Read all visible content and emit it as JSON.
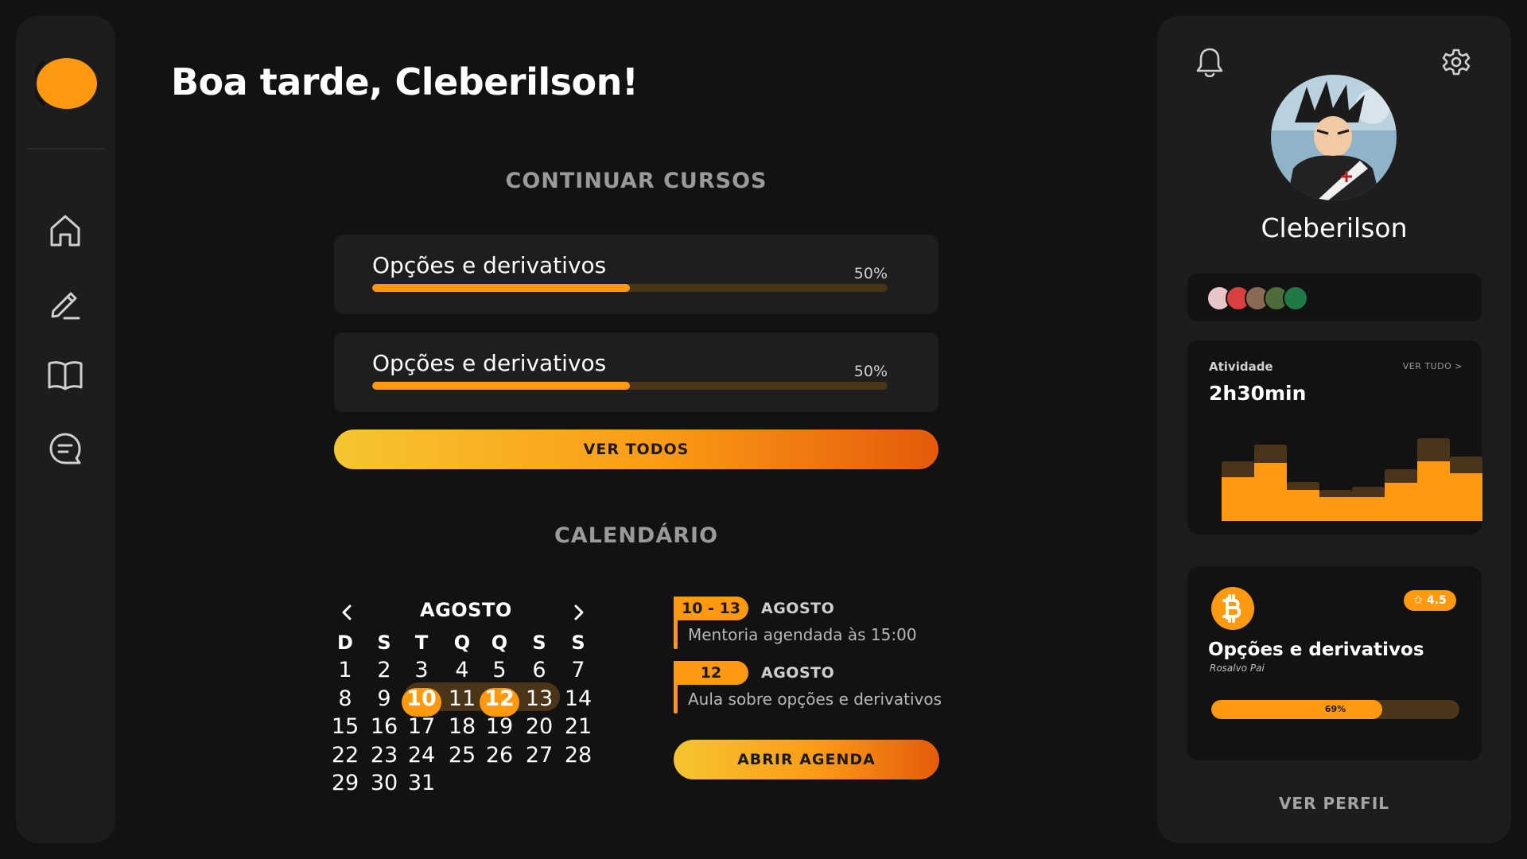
{
  "greeting": "Boa tarde, Cleberilson!",
  "courses_section": {
    "title": "CONTINUAR CURSOS",
    "courses": [
      {
        "name": "Opções e derivativos",
        "progress_label": "50%",
        "progress": 0.5
      },
      {
        "name": "Opções e derivativos",
        "progress_label": "50%",
        "progress": 0.5
      }
    ],
    "see_all_label": "VER TODOS"
  },
  "calendar": {
    "title": "CALENDÁRIO",
    "month": "AGOSTO",
    "weekdays": [
      "D",
      "S",
      "T",
      "Q",
      "Q",
      "S",
      "S"
    ],
    "days": [
      "1",
      "2",
      "3",
      "4",
      "5",
      "6",
      "7",
      "8",
      "9",
      "10",
      "11",
      "12",
      "13",
      "14",
      "15",
      "16",
      "17",
      "18",
      "19",
      "20",
      "21",
      "22",
      "23",
      "24",
      "25",
      "26",
      "27",
      "28",
      "29",
      "30",
      "31"
    ],
    "highlighted_days": [
      "10",
      "12"
    ],
    "range_days": [
      "10",
      "13"
    ]
  },
  "events": [
    {
      "date": "10 - 13",
      "month": "AGOSTO",
      "description": "Mentoria agendada às 15:00"
    },
    {
      "date": "12",
      "month": "AGOSTO",
      "description": "Aula sobre opções e derivativos"
    }
  ],
  "open_agenda_label": "ABRIR AGENDA",
  "profile": {
    "name": "Cleberilson",
    "view_profile_label": "VER PERFIL"
  },
  "activity": {
    "title": "Atividade",
    "see_all_label": "VER TUDO  >",
    "value": "2h30min",
    "bars_total": [
      0.58,
      0.74,
      0.38,
      0.3,
      0.33,
      0.5,
      0.8,
      0.62
    ],
    "bars_done": [
      0.42,
      0.56,
      0.3,
      0.23,
      0.23,
      0.37,
      0.58,
      0.46
    ]
  },
  "featured_course": {
    "icon": "bitcoin-icon",
    "rating": "✩ 4.5",
    "title": "Opções e derivativos",
    "author": "Rosalvo Pai",
    "progress_label": "69%",
    "progress": 0.69
  },
  "nav_icons": [
    "home-icon",
    "edit-icon",
    "book-icon",
    "chat-icon"
  ],
  "colors": {
    "accent": "#ff9910",
    "background": "#121212",
    "panel": "#1d1d1d"
  }
}
